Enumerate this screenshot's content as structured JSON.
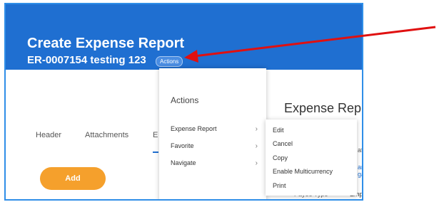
{
  "header": {
    "title": "Create Expense Report",
    "report_id": "ER-0007154 testing 123",
    "actions_label": "Actions"
  },
  "tabs": [
    "Header",
    "Attachments",
    "E"
  ],
  "add_button": "Add",
  "right_panel": {
    "title": "Expense Rep",
    "fragment_aft": "aft",
    "fragment_an": "an",
    "fragment_gai": "gai",
    "payee_type_label": "Payee Type",
    "payee_type_value": "Empl"
  },
  "menu": {
    "title": "Actions",
    "items": [
      "Expense Report",
      "Favorite",
      "Navigate"
    ]
  },
  "submenu": {
    "items": [
      "Edit",
      "Cancel",
      "Copy",
      "Enable Multicurrency",
      "Print"
    ]
  },
  "colors": {
    "banner": "#1f6fd1",
    "frame_border": "#2f8ee8",
    "add_button": "#f5a02c",
    "annotation_arrow": "#e01010"
  }
}
